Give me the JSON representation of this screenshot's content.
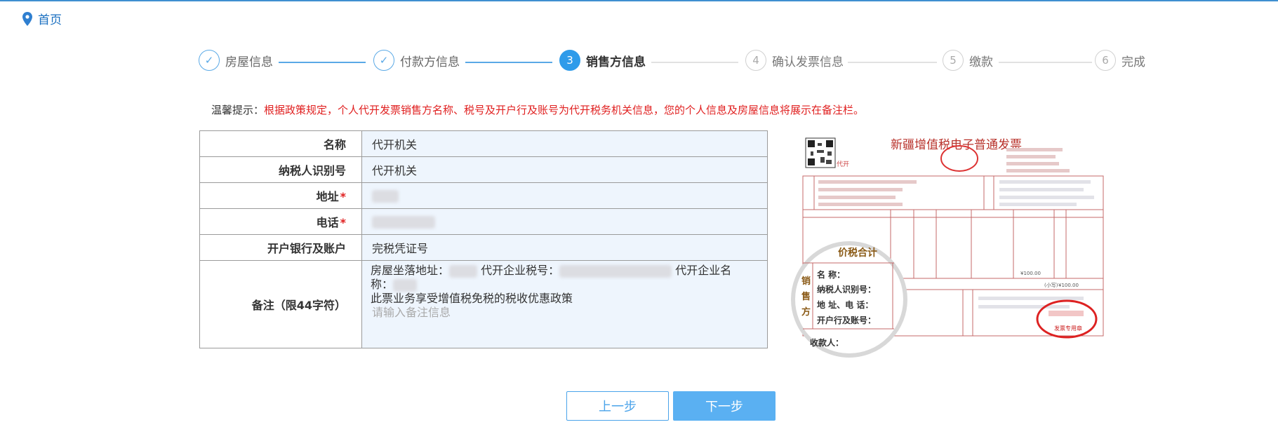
{
  "breadcrumb": {
    "home_label": "首页",
    "icon": "location-pin-icon"
  },
  "steps": [
    {
      "label": "房屋信息",
      "status": "done",
      "marker": "✓"
    },
    {
      "label": "付款方信息",
      "status": "done",
      "marker": "✓"
    },
    {
      "label": "销售方信息",
      "status": "active",
      "marker": "3"
    },
    {
      "label": "确认发票信息",
      "status": "todo",
      "marker": "4"
    },
    {
      "label": "缴款",
      "status": "todo",
      "marker": "5"
    },
    {
      "label": "完成",
      "status": "todo",
      "marker": "6"
    }
  ],
  "tip": {
    "label": "温馨提示：",
    "text": "根据政策规定，个人代开发票销售方名称、税号及开户行及账号为代开税务机关信息，您的个人信息及房屋信息将展示在备注栏。"
  },
  "seller_form": {
    "name_label": "名称",
    "name_value": "代开机关",
    "taxid_label": "纳税人识别号",
    "taxid_value": "代开机关",
    "address_label": "地址",
    "phone_label": "电话",
    "bank_label": "开户银行及账户",
    "bank_value": "完税凭证号",
    "remark_label": "备注（限44字符）",
    "remark_line1_a": "房屋坐落地址：",
    "remark_line1_b": "代开企业税号：",
    "remark_line1_c": "代开企业名",
    "remark_line2": "称：",
    "remark_line3": "此票业务享受增值税免税的税收优惠政策",
    "remark_placeholder": "请输入备注信息",
    "required_mark": "*"
  },
  "invoice_preview": {
    "title": "新疆增值税电子普通发票",
    "tag": "代开",
    "seller_side": [
      "销",
      "售",
      "方"
    ],
    "zoom_lines": [
      "名          称：",
      "纳税人识别号：",
      "地 址、电 话：",
      "开户行及账号："
    ],
    "price_tax": "价税合计",
    "payee": "收款人：",
    "stamp": "发票专用章",
    "amount": "¥100.00",
    "small_label": "(小写)"
  },
  "buttons": {
    "prev": "上一步",
    "next": "下一步"
  },
  "colors": {
    "accent": "#2e9bea",
    "warning": "#e01f1f",
    "field_bg": "#eef5fd"
  }
}
